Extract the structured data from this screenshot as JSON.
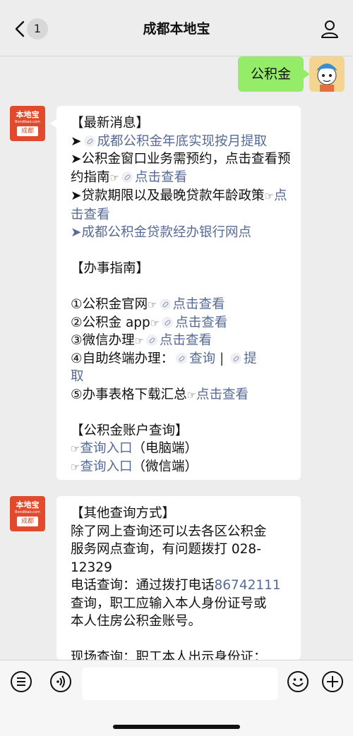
{
  "nav": {
    "title": "成都本地宝",
    "unread_count": "1",
    "back_icon": "chevron-left-icon",
    "profile_icon": "person-icon"
  },
  "chat": {
    "outgoing_text": "公积金",
    "bot_logo": {
      "top": "本地宝",
      "url": "Bendibao.com",
      "city": "成都"
    },
    "msg1": {
      "news_header": "【最新消息】",
      "news1_link": "成都公积金年底实现按月提取",
      "news2_text": "➤公积金窗口业务需预约，点击查看预约指南",
      "news2_link": "点击查看",
      "news3_text": "➤贷款期限以及最晚贷款年龄政策",
      "news3_link": "点击查看",
      "news4_link": "➤成都公积金贷款经办银行网点",
      "guide_header": "【办事指南】",
      "g1_text": "①公积金官网",
      "g1_link": "点击查看",
      "g2_text": "②公积金 app",
      "g2_link": "点击查看",
      "g3_text": "③微信办理",
      "g3_link": "点击查看",
      "g4_text": "④自助终端办理：",
      "g4_link1": "查询",
      "g4_sep": "|",
      "g4_link2a": "提",
      "g4_link2b": "取",
      "g5_text": "⑤办事表格下载汇总",
      "g5_link": "点击查看",
      "account_header": "【公积金账户查询】",
      "acc1_link": "查询入口",
      "acc1_text": "（电脑端）",
      "acc2_link": "查询入口",
      "acc2_text": "（微信端）"
    },
    "msg2": {
      "header": "【其他查询方式】",
      "p1_line1": "除了网上查询还可以去各区公积金",
      "p1_line2": "服务网点查询，有问题拨打 028-",
      "p1_line3": "12329",
      "p2_prefix": "电话查询：通过拨打电话",
      "p2_phone": "86742111",
      "p2_line2": "查询，职工应输入本人身份证号或",
      "p2_line3": "本人住房公积金账号。",
      "p3_line1": "现场查询：职工本人出示身份证："
    }
  },
  "toolbar": {
    "voice_icon": "voice-icon",
    "emoji_icon": "emoji-icon",
    "plus_icon": "plus-icon",
    "menu_icon": "menu-list-icon"
  }
}
